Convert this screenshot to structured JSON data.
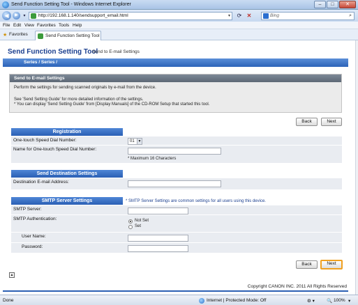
{
  "browser": {
    "window_title": "Send Function Setting Tool - Windows Internet Explorer",
    "url": "http://192.168.1.140/sendsupport_email.html",
    "search_placeholder": "Bing",
    "menu": [
      "File",
      "Edit",
      "View",
      "Favorites",
      "Tools",
      "Help"
    ],
    "favorites_label": "Favorites",
    "tab_title": "Send Function Setting Tool",
    "status_left": "Done",
    "status_zone": "Internet | Protected Mode: Off",
    "zoom": "100%"
  },
  "app": {
    "title": "Send Function Setting Tool",
    "page": "Send to E-mail Settings",
    "series": "Series /        Series /"
  },
  "intro": {
    "heading": "Send to E-mail Settings",
    "line1": "Perform the settings for sending scanned originals by e-mail from the device.",
    "line2": "See 'Send Setting Guide' for more detailed information of the settings.",
    "line3": "* You can display 'Send Setting Guide' from [Display Manuals] of the CD-ROM Setup that started this tool."
  },
  "buttons": {
    "back": "Back",
    "next": "Next"
  },
  "registration": {
    "heading": "Registration",
    "speed_dial_label": "One-touch Speed Dial Number:",
    "speed_dial_value": "01",
    "name_label": "Name for One-touch Speed Dial Number:",
    "name_value": "",
    "name_note": "* Maximum 16 Characters"
  },
  "destination": {
    "heading": "Send Destination Settings",
    "email_label": "Destination E-mail Address:",
    "email_value": ""
  },
  "smtp": {
    "heading": "SMTP Server Settings",
    "note": "* SMTP Server Settings are common settings for all users using this device.",
    "server_label": "SMTP Server:",
    "auth_label": "SMTP Authentication:",
    "auth_options": [
      "Not Set",
      "Set"
    ],
    "auth_selected": "Not Set",
    "user_label": "User Name:",
    "password_label": "Password:"
  },
  "footer": {
    "copyright": "Copyright CANON INC. 2011 All Rights Reserved"
  },
  "colors": {
    "accent_blue": "#2a5fb4",
    "focus_orange": "#f0a020"
  }
}
